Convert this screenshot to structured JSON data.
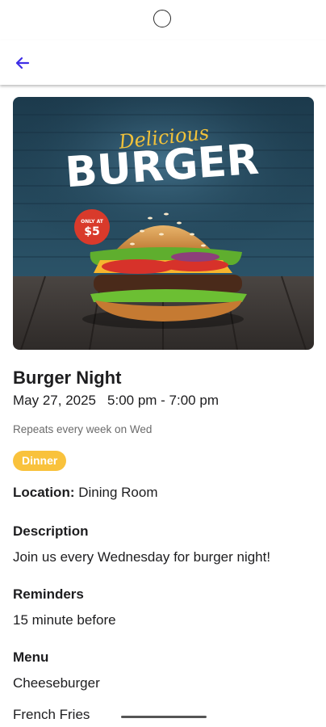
{
  "event": {
    "image_alt": "Burger promotional poster",
    "image_text": {
      "script": "Delicious",
      "headline": "BURGER",
      "price_small": "ONLY AT",
      "price": "$5"
    },
    "title": "Burger Night",
    "date": "May 27, 2025",
    "time": "5:00 pm - 7:00 pm",
    "repeat": "Repeats every week on Wed",
    "tag": "Dinner",
    "location_label": "Location:",
    "location_value": "Dining Room",
    "description_heading": "Description",
    "description": "Join us every Wednesday for burger night!",
    "reminders_heading": "Reminders",
    "reminder": "15 minute before",
    "menu_heading": "Menu",
    "menu_items": [
      "Cheeseburger",
      "French Fries"
    ]
  },
  "icons": {
    "back": "arrow-left-icon"
  },
  "colors": {
    "accent": "#3f2ee6",
    "tag_bg": "#f9c23c",
    "muted": "#6b6b6b"
  }
}
